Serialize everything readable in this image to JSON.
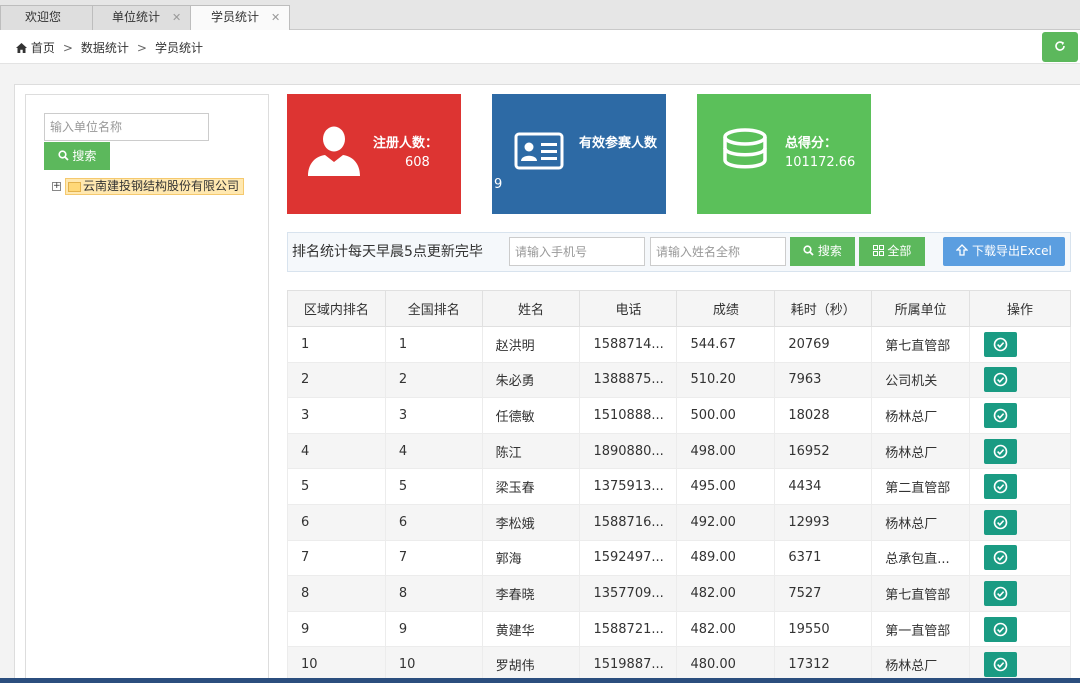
{
  "tabs": [
    {
      "label": "欢迎您",
      "closable": false
    },
    {
      "label": "单位统计",
      "closable": true
    },
    {
      "label": "学员统计",
      "closable": true,
      "active": true
    }
  ],
  "breadcrumb": {
    "home": "首页",
    "level1": "数据统计",
    "level2": "学员统计",
    "separator": ">"
  },
  "tree": {
    "search_placeholder": "输入单位名称",
    "search_label": "搜索",
    "root_node": "云南建投钢结构股份有限公司",
    "root_expander": "+"
  },
  "cards": {
    "registered": {
      "label": "注册人数：",
      "value": "608",
      "color": "#dd3432",
      "icon": "user-icon"
    },
    "participants": {
      "label": "有效参赛人数",
      "value": "9",
      "color": "#2d6aa5",
      "icon": "id-card-icon"
    },
    "total_score": {
      "label": "总得分：",
      "value": "101172.66",
      "color": "#5bc05a",
      "icon": "coins-stack-icon"
    }
  },
  "toolbar": {
    "notice": "排名统计每天早晨5点更新完毕",
    "phone_placeholder": "请输入手机号",
    "name_placeholder": "请输入姓名全称",
    "search_label": "搜索",
    "all_label": "全部",
    "export_label": "下载导出Excel"
  },
  "table": {
    "headers": [
      "区域内排名",
      "全国排名",
      "姓名",
      "电话",
      "成绩",
      "耗时（秒）",
      "所属单位",
      "操作"
    ],
    "rows": [
      {
        "regional_rank": "1",
        "national_rank": "1",
        "name": "赵洪明",
        "phone": "1588714...",
        "score": "544.67",
        "time": "20769",
        "unit": "第七直管部"
      },
      {
        "regional_rank": "2",
        "national_rank": "2",
        "name": "朱必勇",
        "phone": "1388875...",
        "score": "510.20",
        "time": "7963",
        "unit": "公司机关"
      },
      {
        "regional_rank": "3",
        "national_rank": "3",
        "name": "任德敏",
        "phone": "1510888...",
        "score": "500.00",
        "time": "18028",
        "unit": "杨林总厂"
      },
      {
        "regional_rank": "4",
        "national_rank": "4",
        "name": "陈江",
        "phone": "1890880...",
        "score": "498.00",
        "time": "16952",
        "unit": "杨林总厂"
      },
      {
        "regional_rank": "5",
        "national_rank": "5",
        "name": "梁玉春",
        "phone": "1375913...",
        "score": "495.00",
        "time": "4434",
        "unit": "第二直管部"
      },
      {
        "regional_rank": "6",
        "national_rank": "6",
        "name": "李松娥",
        "phone": "1588716...",
        "score": "492.00",
        "time": "12993",
        "unit": "杨林总厂"
      },
      {
        "regional_rank": "7",
        "national_rank": "7",
        "name": "郭海",
        "phone": "1592497...",
        "score": "489.00",
        "time": "6371",
        "unit": "总承包直..."
      },
      {
        "regional_rank": "8",
        "national_rank": "8",
        "name": "李春晓",
        "phone": "1357709...",
        "score": "482.00",
        "time": "7527",
        "unit": "第七直管部"
      },
      {
        "regional_rank": "9",
        "national_rank": "9",
        "name": "黄建华",
        "phone": "1588721...",
        "score": "482.00",
        "time": "19550",
        "unit": "第一直管部"
      },
      {
        "regional_rank": "10",
        "national_rank": "10",
        "name": "罗胡伟",
        "phone": "1519887...",
        "score": "480.00",
        "time": "17312",
        "unit": "杨林总厂"
      }
    ]
  },
  "colors": {
    "success": "#5cb85c",
    "op_button": "#1a9b83",
    "export_button": "#5b9ee0"
  }
}
